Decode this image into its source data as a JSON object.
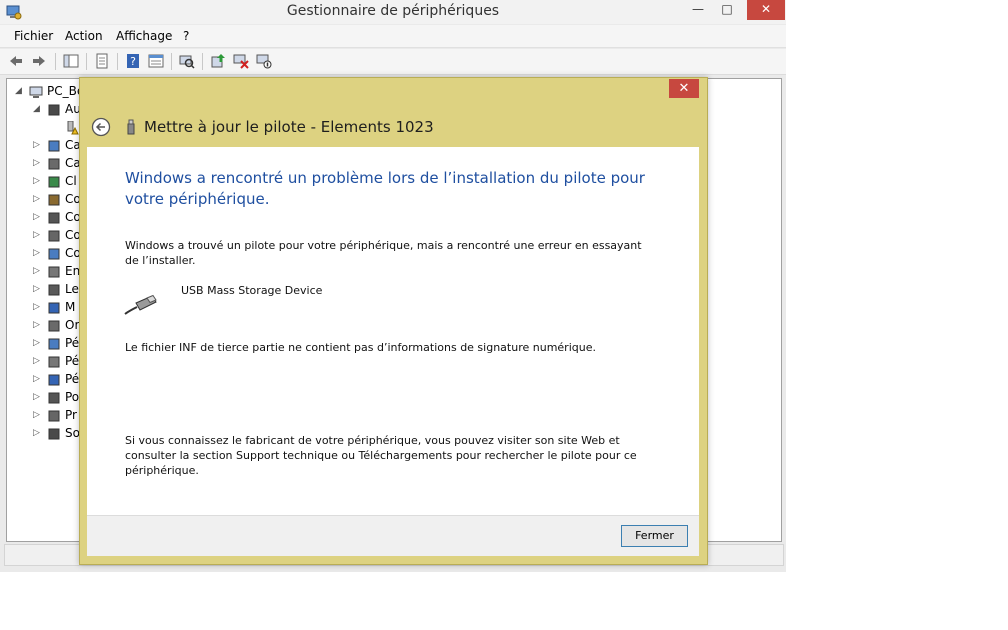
{
  "main_window": {
    "title": "Gestionnaire de périphériques",
    "caption_buttons": {
      "minimize": "—",
      "maximize": "□",
      "close": "✕"
    },
    "menu": [
      "Fichier",
      "Action",
      "Affichage",
      "?"
    ],
    "tree": [
      {
        "label": "PC_Be",
        "indent": 0,
        "expanded": true
      },
      {
        "label": "Au",
        "indent": 1,
        "expanded": true
      },
      {
        "label": "",
        "indent": 2,
        "warning": true
      },
      {
        "label": "Ca",
        "indent": 1
      },
      {
        "label": "Ca",
        "indent": 1
      },
      {
        "label": "Cl",
        "indent": 1
      },
      {
        "label": "Co",
        "indent": 1
      },
      {
        "label": "Co",
        "indent": 1
      },
      {
        "label": "Co",
        "indent": 1
      },
      {
        "label": "Co",
        "indent": 1
      },
      {
        "label": "En",
        "indent": 1
      },
      {
        "label": "Le",
        "indent": 1
      },
      {
        "label": "M",
        "indent": 1
      },
      {
        "label": "Or",
        "indent": 1
      },
      {
        "label": "Pé",
        "indent": 1
      },
      {
        "label": "Pé",
        "indent": 1
      },
      {
        "label": "Pé",
        "indent": 1
      },
      {
        "label": "Po",
        "indent": 1
      },
      {
        "label": "Pr",
        "indent": 1
      },
      {
        "label": "So",
        "indent": 1
      }
    ]
  },
  "dialog": {
    "close_glyph": "✕",
    "title": "Mettre à jour le pilote - Elements 1023",
    "heading": "Windows a rencontré un problème lors de l’installation du pilote pour votre périphérique.",
    "paragraph1": "Windows a trouvé un pilote pour votre périphérique, mais a rencontré une erreur en essayant de l’installer.",
    "device_name": "USB Mass Storage Device",
    "paragraph2": "Le fichier INF de tierce partie ne contient pas d’informations de signature numérique.",
    "paragraph3": "Si vous connaissez le fabricant de votre périphérique, vous pouvez visiter son site Web et consulter la section Support technique ou Téléchargements pour rechercher le pilote pour ce périphérique.",
    "close_button": "Fermer"
  },
  "colors": {
    "dialog_frame": "#ddd281",
    "heading_blue": "#1f4fa0",
    "close_red": "#c7483f"
  }
}
